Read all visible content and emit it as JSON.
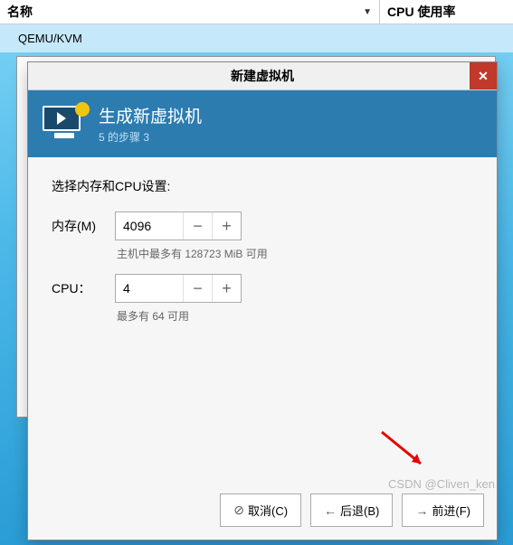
{
  "table": {
    "col_name": "名称",
    "col_cpu": "CPU 使用率",
    "row0": "QEMU/KVM"
  },
  "dialog": {
    "title": "新建虚拟机",
    "header_title": "生成新虚拟机",
    "header_sub": "5 的步骤 3",
    "section_title": "选择内存和CPU设置:",
    "mem_label": "内存(M)",
    "mem_value": "4096",
    "mem_hint": "主机中最多有 128723 MiB 可用",
    "cpu_label": "CPU：",
    "cpu_value": "4",
    "cpu_hint": "最多有 64 可用",
    "btn_cancel": "取消(C)",
    "btn_back": "后退(B)",
    "btn_forward": "前进(F)"
  },
  "watermark": "CSDN @Cliven_ken"
}
